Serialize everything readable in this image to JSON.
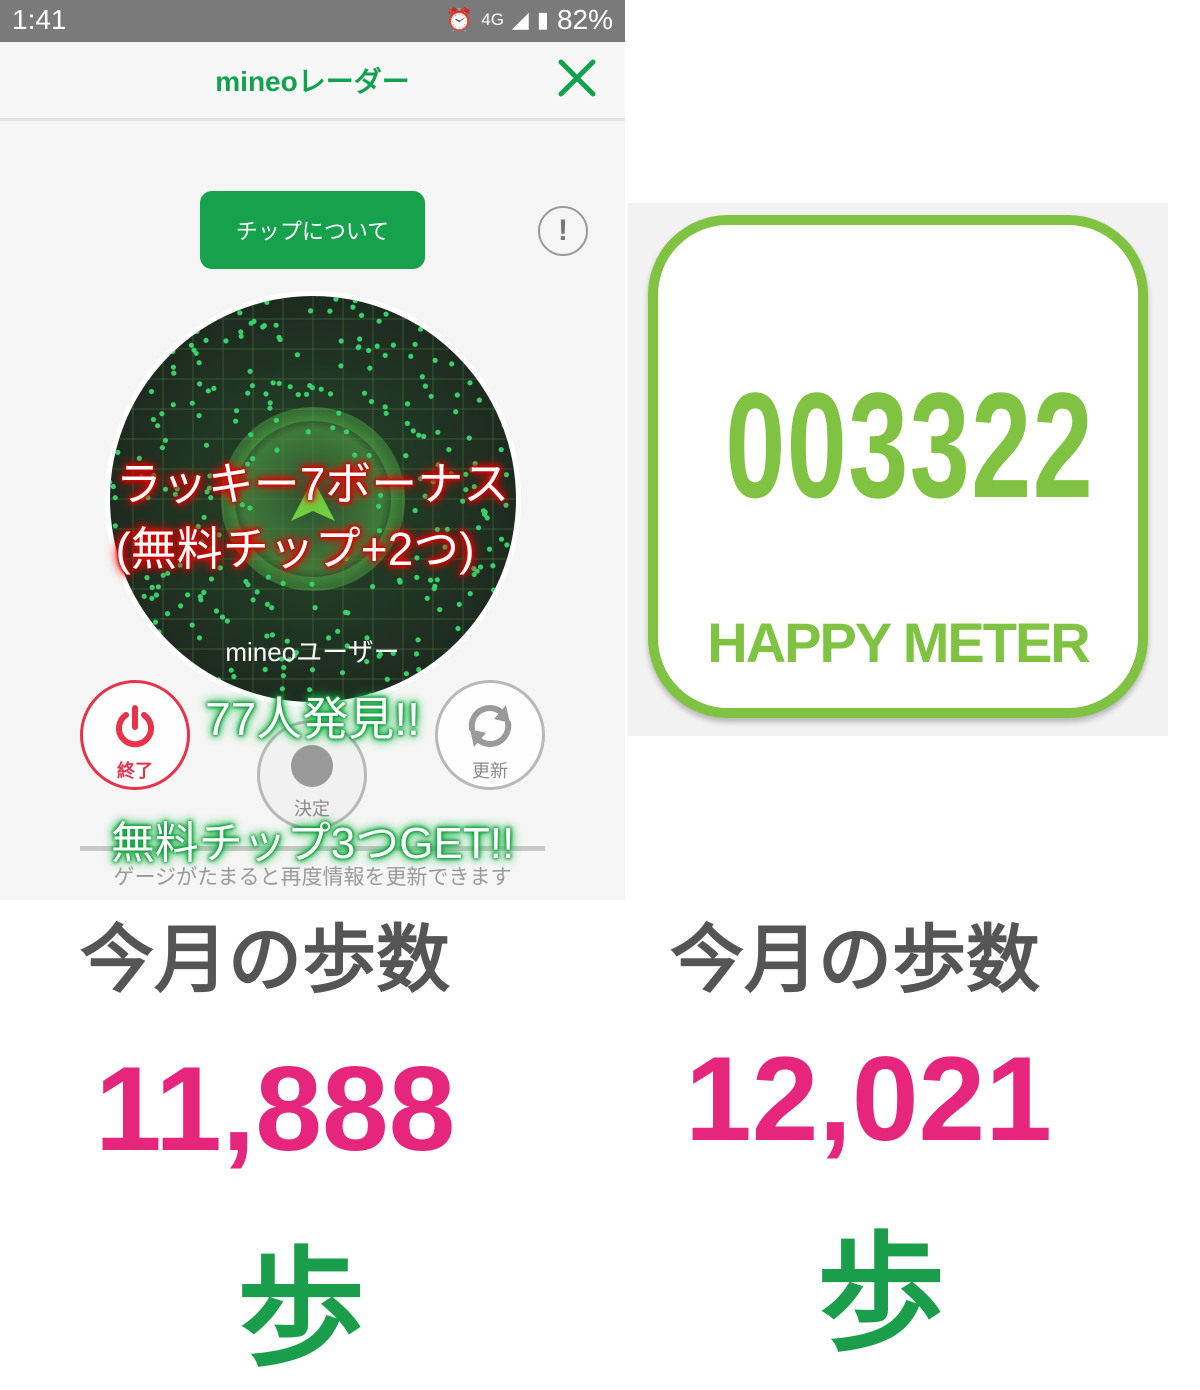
{
  "status_bar": {
    "time": "1:41",
    "network": "4G",
    "battery": "82%"
  },
  "header": {
    "title": "mineoレーダー"
  },
  "radar": {
    "chip_button_label": "チップについて",
    "info_icon_text": "!",
    "bonus_line1": "ラッキー7ボーナス",
    "bonus_line2": "(無料チップ+2つ)",
    "user_label": "mineoユーザー",
    "found_count": "77人発見!!",
    "end_label": "終了",
    "decide_label": "決定",
    "refresh_label": "更新",
    "free_chip_get": "無料チップ3つGET!!",
    "gauge_note": "ゲージがたまると再度情報を更新できます"
  },
  "happy_meter": {
    "value": "003322",
    "label": "HAPPY METER"
  },
  "steps_left": {
    "title": "今月の歩数",
    "value": "11,888",
    "unit": "歩"
  },
  "steps_right": {
    "title": "今月の歩数",
    "value": "12,021",
    "unit": "歩"
  },
  "colors": {
    "accent_green": "#16a14c",
    "meter_green": "#80c342",
    "steps_pink": "#e6267d",
    "end_red": "#e8324a"
  }
}
